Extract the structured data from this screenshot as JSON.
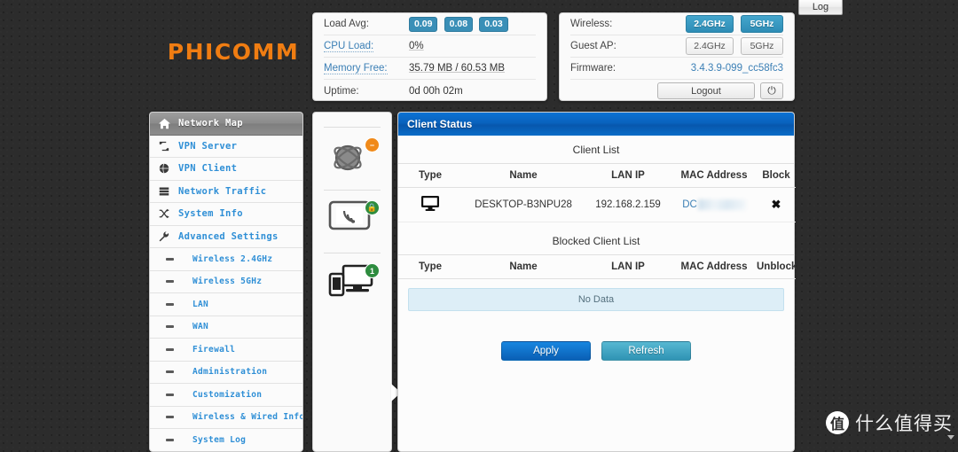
{
  "topbar": {
    "log_label": "Log"
  },
  "brand": {
    "name": "PHICOMM",
    "color": "#f07d12"
  },
  "system_status": {
    "rows": [
      {
        "label": "Load Avg:",
        "type": "badges",
        "values": [
          "0.09",
          "0.08",
          "0.03"
        ]
      },
      {
        "label": "CPU Load:",
        "type": "text",
        "value": "0%",
        "label_link": true
      },
      {
        "label": "Memory Free:",
        "type": "text",
        "value": "35.79 MB / 60.53 MB",
        "label_link": true
      },
      {
        "label": "Uptime:",
        "type": "text",
        "value": "0d 00h 02m",
        "label_link": false
      }
    ]
  },
  "device_status": {
    "wireless_label": "Wireless:",
    "wireless_pills": [
      {
        "label": "2.4GHz",
        "active": true
      },
      {
        "label": "5GHz",
        "active": true
      }
    ],
    "guest_label": "Guest AP:",
    "guest_pills": [
      {
        "label": "2.4GHz",
        "active": false
      },
      {
        "label": "5GHz",
        "active": false
      }
    ],
    "firmware_label": "Firmware:",
    "firmware_value": "3.4.3.9-099_cc58fc3",
    "logout_label": "Logout",
    "power_icon": "power-icon"
  },
  "sidebar": {
    "items": [
      {
        "label": "Network Map",
        "icon": "home-icon",
        "active": true,
        "sub": false
      },
      {
        "label": "VPN Server",
        "icon": "repeat-icon",
        "active": false,
        "sub": false
      },
      {
        "label": "VPN Client",
        "icon": "globe-icon",
        "active": false,
        "sub": false
      },
      {
        "label": "Network Traffic",
        "icon": "list-icon",
        "active": false,
        "sub": false
      },
      {
        "label": "System Info",
        "icon": "shuffle-icon",
        "active": false,
        "sub": false
      },
      {
        "label": "Advanced Settings",
        "icon": "wrench-icon",
        "active": false,
        "sub": false
      },
      {
        "label": "Wireless 2.4GHz",
        "icon": "dash-icon",
        "active": false,
        "sub": true
      },
      {
        "label": "Wireless 5GHz",
        "icon": "dash-icon",
        "active": false,
        "sub": true
      },
      {
        "label": "LAN",
        "icon": "dash-icon",
        "active": false,
        "sub": true
      },
      {
        "label": "WAN",
        "icon": "dash-icon",
        "active": false,
        "sub": true
      },
      {
        "label": "Firewall",
        "icon": "dash-icon",
        "active": false,
        "sub": true
      },
      {
        "label": "Administration",
        "icon": "dash-icon",
        "active": false,
        "sub": true
      },
      {
        "label": "Customization",
        "icon": "dash-icon",
        "active": false,
        "sub": true
      },
      {
        "label": "Wireless & Wired Info",
        "icon": "dash-icon",
        "active": false,
        "sub": true
      },
      {
        "label": "System Log",
        "icon": "dash-icon",
        "active": false,
        "sub": true
      }
    ]
  },
  "topology": {
    "nodes": [
      {
        "name": "internet-globe-icon",
        "badge": "−",
        "badge_color": "#f08a1a"
      },
      {
        "name": "router-wireless-icon",
        "badge": "🔒",
        "badge_color": "#2e8c3f"
      },
      {
        "name": "clients-devices-icon",
        "badge": "1",
        "badge_color": "#2e8c3f"
      }
    ]
  },
  "client_status": {
    "title": "Client Status",
    "client_list_title": "Client List",
    "columns": [
      "Type",
      "Name",
      "LAN IP",
      "MAC Address",
      "Block"
    ],
    "rows": [
      {
        "type_icon": "desktop-icon",
        "name": "DESKTOP-B3NPU28",
        "lan_ip": "192.168.2.159",
        "mac": "DC",
        "mac_redacted": true,
        "action": "✖"
      }
    ],
    "blocked_list_title": "Blocked Client List",
    "blocked_columns": [
      "Type",
      "Name",
      "LAN IP",
      "MAC Address",
      "Unblock"
    ],
    "blocked_empty_text": "No Data",
    "apply_label": "Apply",
    "refresh_label": "Refresh"
  },
  "watermark": {
    "mark": "值",
    "text": "什么值得买"
  }
}
